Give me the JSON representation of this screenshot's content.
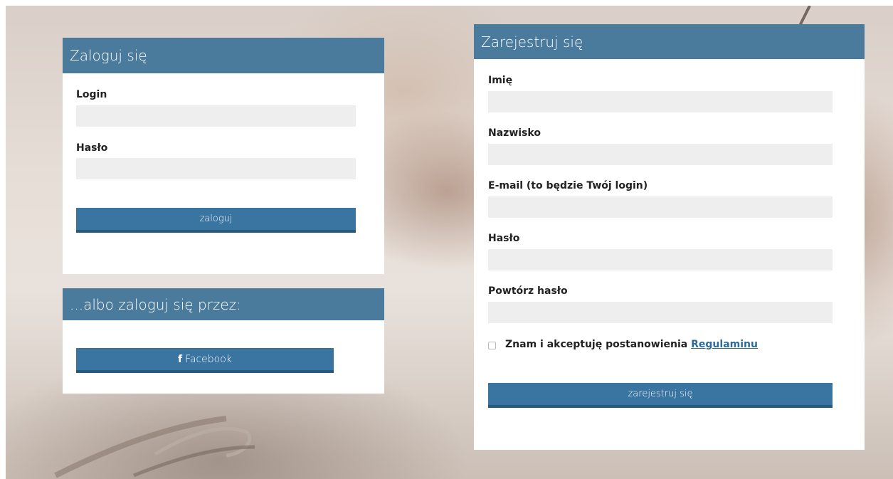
{
  "login": {
    "title": "Zaloguj się",
    "login_label": "Login",
    "password_label": "Hasło",
    "submit_label": "zaloguj"
  },
  "social": {
    "title": "...albo zaloguj się przez:",
    "facebook_icon": "f",
    "facebook_label": "Facebook"
  },
  "register": {
    "title": "Zarejestruj się",
    "first_name_label": "Imię",
    "last_name_label": "Nazwisko",
    "email_label": "E-mail (to będzie Twój login)",
    "password_label": "Hasło",
    "repeat_password_label": "Powtórz hasło",
    "terms_text": "Znam i akceptuję postanowienia ",
    "terms_link": "Regulaminu",
    "submit_label": "zarejestruj się"
  },
  "colors": {
    "header": "#4a7a9c",
    "button": "#3a74a1",
    "input_bg": "#eeeeee"
  }
}
